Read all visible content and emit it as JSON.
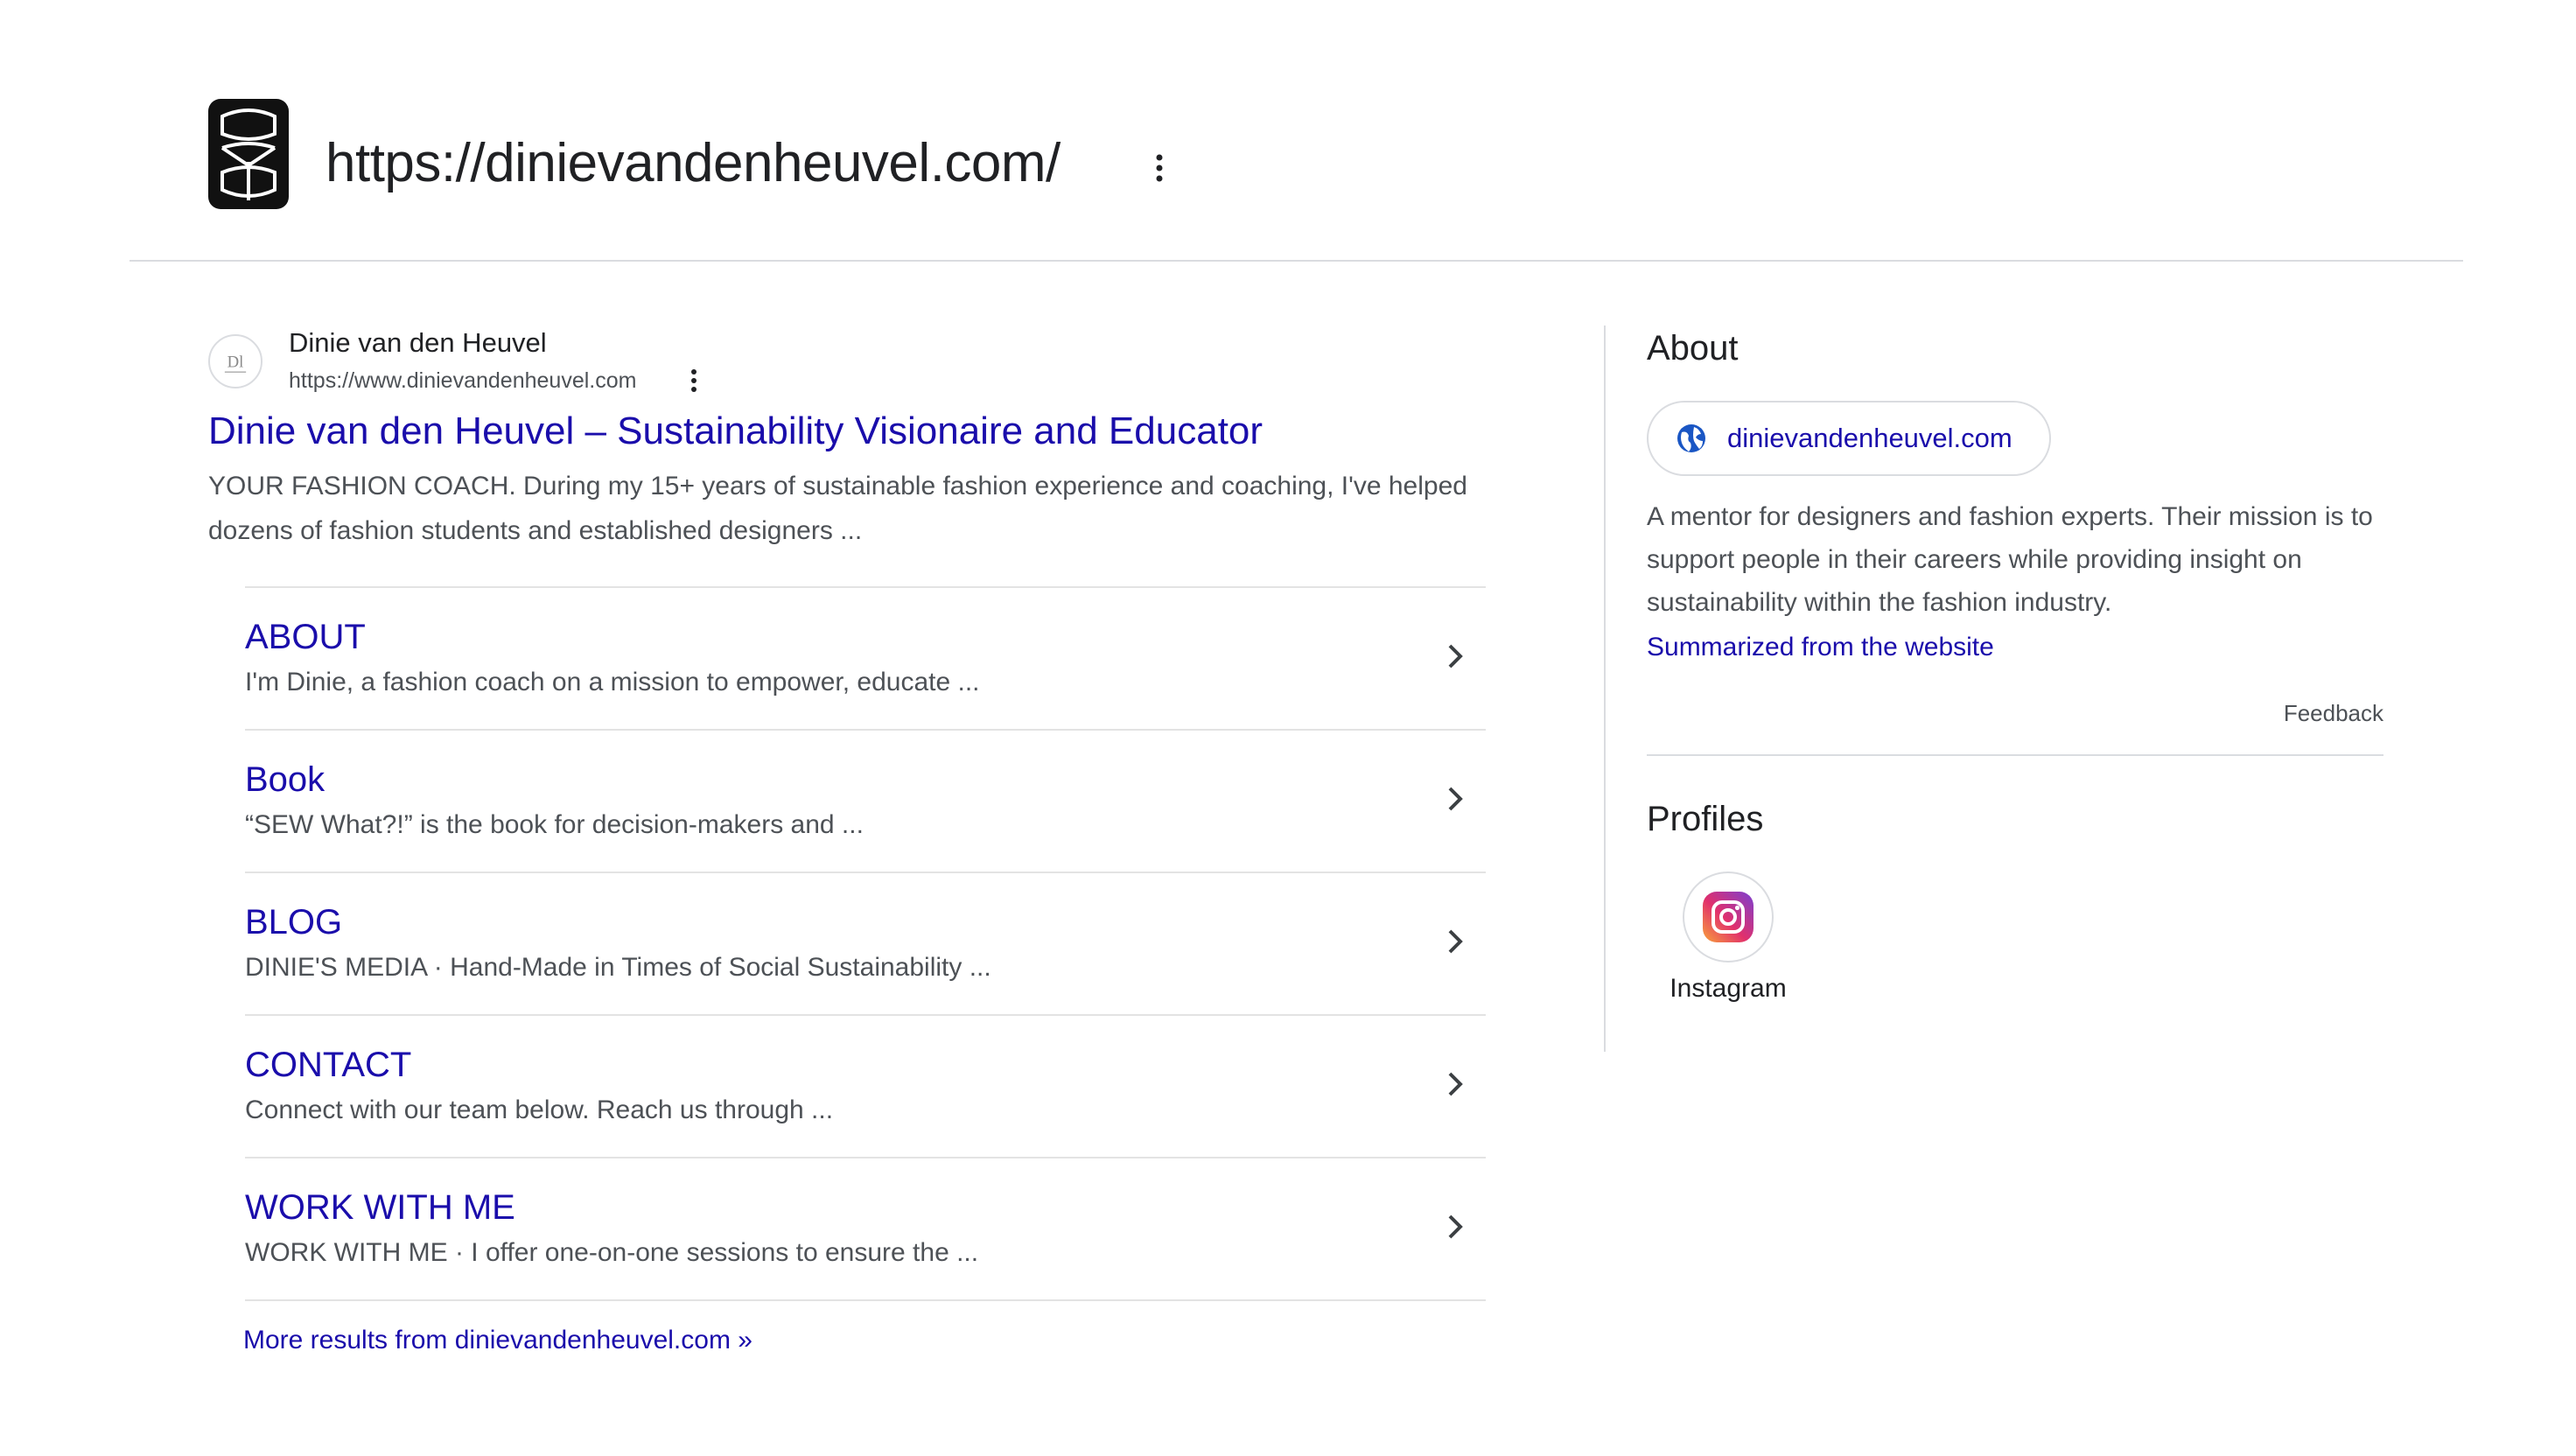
{
  "header": {
    "url": "https://dinievandenheuvel.com/",
    "logo_icon": "dvh-monogram-logo",
    "menu_icon": "vertical-dots-icon"
  },
  "result": {
    "site_name": "Dinie van den Heuvel",
    "site_url": "https://www.dinievandenheuvel.com",
    "title": "Dinie van den Heuvel – Sustainability Visionaire and Educator",
    "snippet": "YOUR FASHION COACH. During my 15+ years of sustainable fashion experience and coaching, I've helped dozens of fashion students and established designers ...",
    "sitelinks": [
      {
        "title": "ABOUT",
        "description": "I'm Dinie, a fashion coach on a mission to empower, educate ..."
      },
      {
        "title": "Book",
        "description": "“SEW What?!” is the book for decision-makers and ..."
      },
      {
        "title": "BLOG",
        "description": "DINIE'S MEDIA · Hand-Made in Times of Social Sustainability ..."
      },
      {
        "title": "CONTACT",
        "description": "Connect with our team below. Reach us through ..."
      },
      {
        "title": "WORK WITH ME",
        "description": "WORK WITH ME · I offer one-on-one sessions to ensure the ..."
      }
    ],
    "more_results": "More results from dinievandenheuvel.com »"
  },
  "about": {
    "heading": "About",
    "site_chip": "dinievandenheuvel.com",
    "description": "A mentor for designers and fashion experts. Their mission is to support people in their careers while providing insight on sustainability within the fashion industry.",
    "summarized_link": "Summarized from the website",
    "feedback": "Feedback"
  },
  "profiles": {
    "heading": "Profiles",
    "items": [
      {
        "label": "Instagram",
        "icon": "instagram-icon"
      }
    ]
  },
  "colors": {
    "link": "#1a0dab",
    "text": "#202124",
    "secondary_text": "#4d5156",
    "divider": "#dadce0"
  }
}
